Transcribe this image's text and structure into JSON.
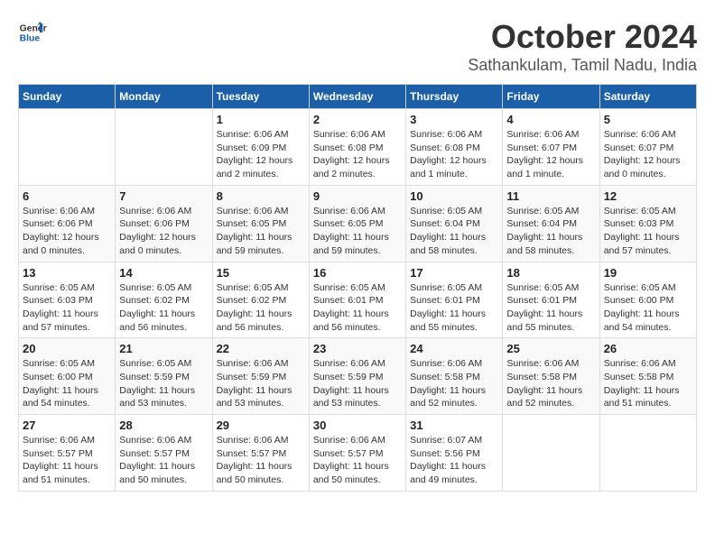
{
  "logo": {
    "line1": "General",
    "line2": "Blue"
  },
  "title": "October 2024",
  "subtitle": "Sathankulam, Tamil Nadu, India",
  "days_header": [
    "Sunday",
    "Monday",
    "Tuesday",
    "Wednesday",
    "Thursday",
    "Friday",
    "Saturday"
  ],
  "weeks": [
    [
      {
        "day": "",
        "info": ""
      },
      {
        "day": "",
        "info": ""
      },
      {
        "day": "1",
        "info": "Sunrise: 6:06 AM\nSunset: 6:09 PM\nDaylight: 12 hours\nand 2 minutes."
      },
      {
        "day": "2",
        "info": "Sunrise: 6:06 AM\nSunset: 6:08 PM\nDaylight: 12 hours\nand 2 minutes."
      },
      {
        "day": "3",
        "info": "Sunrise: 6:06 AM\nSunset: 6:08 PM\nDaylight: 12 hours\nand 1 minute."
      },
      {
        "day": "4",
        "info": "Sunrise: 6:06 AM\nSunset: 6:07 PM\nDaylight: 12 hours\nand 1 minute."
      },
      {
        "day": "5",
        "info": "Sunrise: 6:06 AM\nSunset: 6:07 PM\nDaylight: 12 hours\nand 0 minutes."
      }
    ],
    [
      {
        "day": "6",
        "info": "Sunrise: 6:06 AM\nSunset: 6:06 PM\nDaylight: 12 hours\nand 0 minutes."
      },
      {
        "day": "7",
        "info": "Sunrise: 6:06 AM\nSunset: 6:06 PM\nDaylight: 12 hours\nand 0 minutes."
      },
      {
        "day": "8",
        "info": "Sunrise: 6:06 AM\nSunset: 6:05 PM\nDaylight: 11 hours\nand 59 minutes."
      },
      {
        "day": "9",
        "info": "Sunrise: 6:06 AM\nSunset: 6:05 PM\nDaylight: 11 hours\nand 59 minutes."
      },
      {
        "day": "10",
        "info": "Sunrise: 6:05 AM\nSunset: 6:04 PM\nDaylight: 11 hours\nand 58 minutes."
      },
      {
        "day": "11",
        "info": "Sunrise: 6:05 AM\nSunset: 6:04 PM\nDaylight: 11 hours\nand 58 minutes."
      },
      {
        "day": "12",
        "info": "Sunrise: 6:05 AM\nSunset: 6:03 PM\nDaylight: 11 hours\nand 57 minutes."
      }
    ],
    [
      {
        "day": "13",
        "info": "Sunrise: 6:05 AM\nSunset: 6:03 PM\nDaylight: 11 hours\nand 57 minutes."
      },
      {
        "day": "14",
        "info": "Sunrise: 6:05 AM\nSunset: 6:02 PM\nDaylight: 11 hours\nand 56 minutes."
      },
      {
        "day": "15",
        "info": "Sunrise: 6:05 AM\nSunset: 6:02 PM\nDaylight: 11 hours\nand 56 minutes."
      },
      {
        "day": "16",
        "info": "Sunrise: 6:05 AM\nSunset: 6:01 PM\nDaylight: 11 hours\nand 56 minutes."
      },
      {
        "day": "17",
        "info": "Sunrise: 6:05 AM\nSunset: 6:01 PM\nDaylight: 11 hours\nand 55 minutes."
      },
      {
        "day": "18",
        "info": "Sunrise: 6:05 AM\nSunset: 6:01 PM\nDaylight: 11 hours\nand 55 minutes."
      },
      {
        "day": "19",
        "info": "Sunrise: 6:05 AM\nSunset: 6:00 PM\nDaylight: 11 hours\nand 54 minutes."
      }
    ],
    [
      {
        "day": "20",
        "info": "Sunrise: 6:05 AM\nSunset: 6:00 PM\nDaylight: 11 hours\nand 54 minutes."
      },
      {
        "day": "21",
        "info": "Sunrise: 6:05 AM\nSunset: 5:59 PM\nDaylight: 11 hours\nand 53 minutes."
      },
      {
        "day": "22",
        "info": "Sunrise: 6:06 AM\nSunset: 5:59 PM\nDaylight: 11 hours\nand 53 minutes."
      },
      {
        "day": "23",
        "info": "Sunrise: 6:06 AM\nSunset: 5:59 PM\nDaylight: 11 hours\nand 53 minutes."
      },
      {
        "day": "24",
        "info": "Sunrise: 6:06 AM\nSunset: 5:58 PM\nDaylight: 11 hours\nand 52 minutes."
      },
      {
        "day": "25",
        "info": "Sunrise: 6:06 AM\nSunset: 5:58 PM\nDaylight: 11 hours\nand 52 minutes."
      },
      {
        "day": "26",
        "info": "Sunrise: 6:06 AM\nSunset: 5:58 PM\nDaylight: 11 hours\nand 51 minutes."
      }
    ],
    [
      {
        "day": "27",
        "info": "Sunrise: 6:06 AM\nSunset: 5:57 PM\nDaylight: 11 hours\nand 51 minutes."
      },
      {
        "day": "28",
        "info": "Sunrise: 6:06 AM\nSunset: 5:57 PM\nDaylight: 11 hours\nand 50 minutes."
      },
      {
        "day": "29",
        "info": "Sunrise: 6:06 AM\nSunset: 5:57 PM\nDaylight: 11 hours\nand 50 minutes."
      },
      {
        "day": "30",
        "info": "Sunrise: 6:06 AM\nSunset: 5:57 PM\nDaylight: 11 hours\nand 50 minutes."
      },
      {
        "day": "31",
        "info": "Sunrise: 6:07 AM\nSunset: 5:56 PM\nDaylight: 11 hours\nand 49 minutes."
      },
      {
        "day": "",
        "info": ""
      },
      {
        "day": "",
        "info": ""
      }
    ]
  ]
}
